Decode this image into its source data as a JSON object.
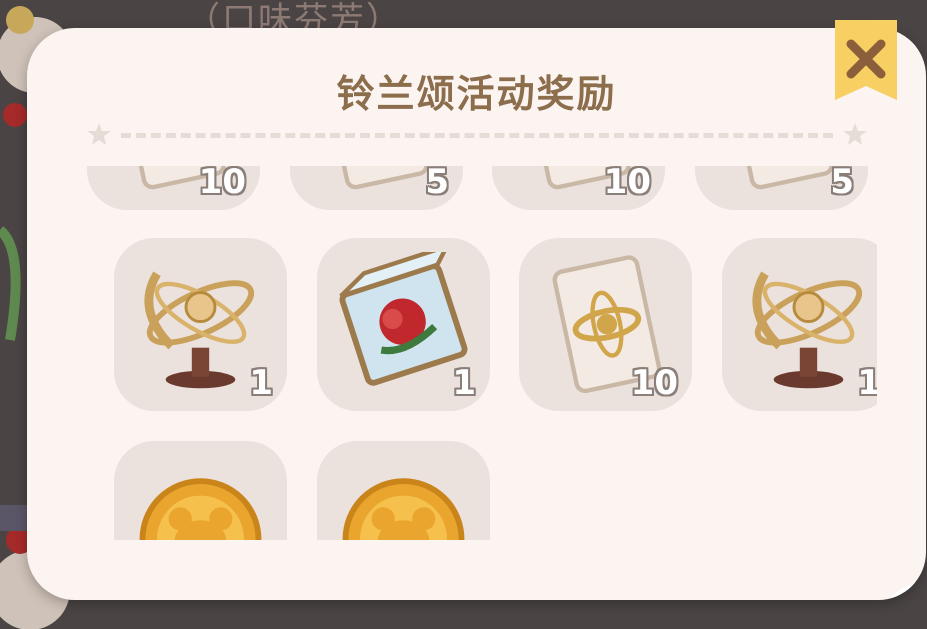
{
  "background": {
    "top_text": "（口味芬芳）"
  },
  "dialog": {
    "title": "铃兰颂活动奖励",
    "close_label": "close"
  },
  "rewards": {
    "row1": [
      {
        "name": "reward-card-top",
        "icon": "scroll-card-icon",
        "count": "10"
      },
      {
        "name": "reward-card-top",
        "icon": "scroll-card-icon",
        "count": "5"
      },
      {
        "name": "reward-card-top",
        "icon": "scroll-card-icon",
        "count": "10"
      },
      {
        "name": "reward-card-top",
        "icon": "scroll-card-icon",
        "count": "5"
      }
    ],
    "row2": [
      {
        "icon": "golden-orb-trophy-icon",
        "count": "1"
      },
      {
        "icon": "rose-crystal-box-icon",
        "count": "1"
      },
      {
        "icon": "scroll-card-icon",
        "count": "10"
      },
      {
        "icon": "golden-orb-trophy-icon",
        "count": "1"
      }
    ],
    "row3": [
      {
        "icon": "bear-coin-icon",
        "count": ""
      },
      {
        "icon": "bear-coin-icon",
        "count": ""
      }
    ]
  },
  "colors": {
    "modal_bg": "#fbf4f1",
    "tile_bg": "#ebe1dd",
    "title": "#8c6d4c",
    "close_button": "#f7cf63"
  }
}
